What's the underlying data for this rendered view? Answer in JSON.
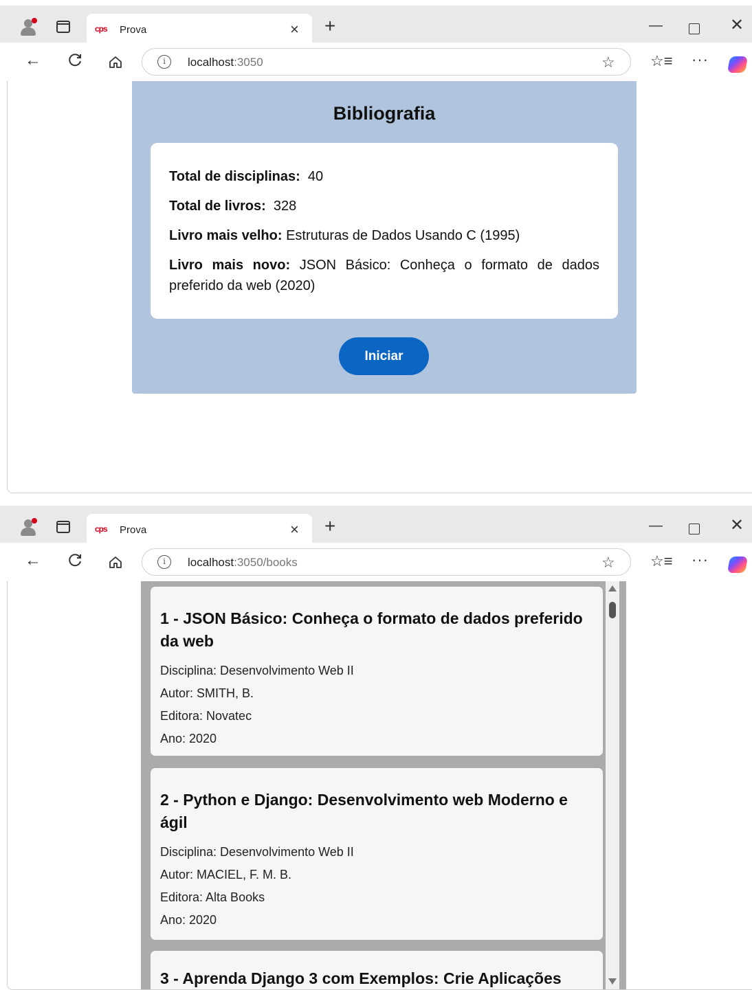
{
  "windows": [
    {
      "tab_title": "Prova",
      "favicon_text": "cps",
      "url_host": "localhost",
      "url_rest": ":3050"
    },
    {
      "tab_title": "Prova",
      "favicon_text": "cps",
      "url_host": "localhost",
      "url_rest": ":3050/books"
    }
  ],
  "browser": {
    "new_tab": "+",
    "close_tab": "×",
    "minimize": "—",
    "close_window": "✕",
    "back": "←",
    "reload": "C",
    "info": "i",
    "star": "☆",
    "favorites": "☆≡",
    "more": "···"
  },
  "home": {
    "title": "Bibliografia",
    "total_disciplinas_label": "Total de disciplinas:",
    "total_disciplinas_value": "40",
    "total_livros_label": "Total de livros:",
    "total_livros_value": "328",
    "livro_velho_label": "Livro mais velho:",
    "livro_velho_value": "Estruturas de Dados Usando C (1995)",
    "livro_novo_label": "Livro mais novo:",
    "livro_novo_value": "JSON Básico: Conheça o formato de dados preferido da web (2020)",
    "start_button": "Iniciar"
  },
  "books": [
    {
      "title": "1 - JSON Básico: Conheça o formato de dados preferido da web",
      "disciplina": "Disciplina: Desenvolvimento Web II",
      "autor": "Autor: SMITH, B.",
      "editora": "Editora: Novatec",
      "ano": "Ano: 2020"
    },
    {
      "title": "2 - Python e Django: Desenvolvimento web Moderno e ágil",
      "disciplina": "Disciplina: Desenvolvimento Web II",
      "autor": "Autor: MACIEL, F. M. B.",
      "editora": "Editora: Alta Books",
      "ano": "Ano: 2020"
    },
    {
      "title": "3 - Aprenda Django 3 com Exemplos: Crie Aplicações"
    }
  ]
}
